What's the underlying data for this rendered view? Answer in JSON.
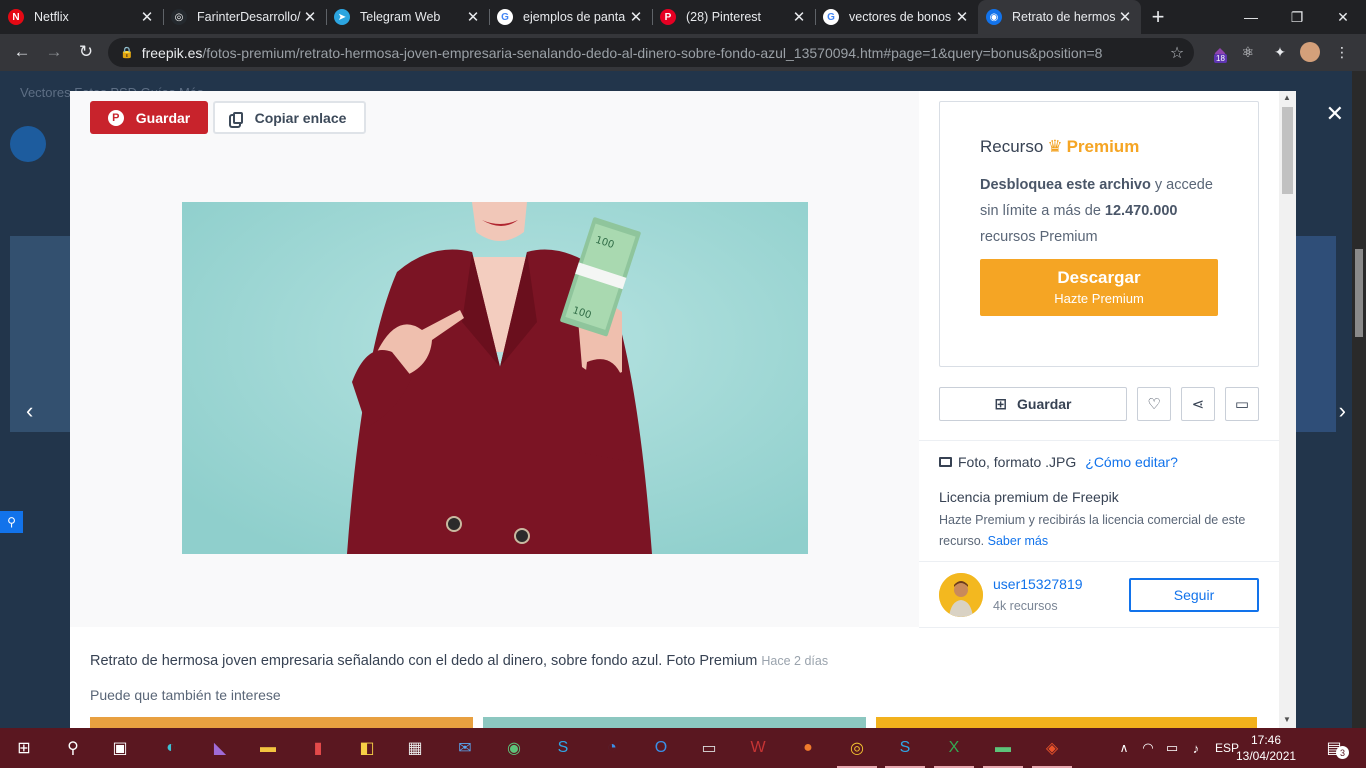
{
  "browser": {
    "tabs": [
      {
        "title": "Netflix",
        "favicon": "netflix-icon",
        "color": "#e50914",
        "glyph": "N",
        "active": false
      },
      {
        "title": "FarinterDesarrollo/",
        "favicon": "github-icon",
        "color": "#24292e",
        "glyph": "◎",
        "active": false
      },
      {
        "title": "Telegram Web",
        "favicon": "telegram-icon",
        "color": "#2ca5e0",
        "glyph": "➤",
        "active": false
      },
      {
        "title": "ejemplos de panta",
        "favicon": "google-icon",
        "color": "#ffffff",
        "glyph": "G",
        "active": false
      },
      {
        "title": "(28) Pinterest",
        "favicon": "pinterest-icon",
        "color": "#e60023",
        "glyph": "P",
        "active": false
      },
      {
        "title": "vectores de bonos",
        "favicon": "google-icon",
        "color": "#ffffff",
        "glyph": "G",
        "active": false
      },
      {
        "title": "Retrato de hermos",
        "favicon": "freepik-icon",
        "color": "#1273eb",
        "glyph": "◉",
        "active": true
      }
    ],
    "url_domain": "freepik.es",
    "url_path": "/fotos-premium/retrato-hermosa-joven-empresaria-senalando-dedo-al-dinero-sobre-fondo-azul_13570094.htm#page=1&query=bonus&position=8",
    "ext_badge": "18"
  },
  "backdrop": {
    "nav_text": "Vectores   Fotos   PSD   Guías   Más"
  },
  "modal": {
    "pin_save_label": "Guardar",
    "copy_link_label": "Copiar enlace",
    "premium": {
      "title_prefix": "Recurso",
      "title_premium": "Premium",
      "desc_bold1": "Desbloquea este archivo",
      "desc_text1": " y accede sin límite a más de ",
      "desc_bold2": "12.470.000",
      "desc_text2": " recursos Premium",
      "download_label": "Descargar",
      "download_sub": "Hazte Premium"
    },
    "save_label": "Guardar",
    "format_text": "Foto, formato .JPG",
    "howto_link": "¿Cómo editar?",
    "license_title": "Licencia premium de Freepik",
    "license_desc": "Hazte Premium y recibirás la licencia comercial de este recurso.",
    "license_link": "Saber más",
    "author_name": "user15327819",
    "author_count": "4k recursos",
    "follow_label": "Seguir",
    "description": "Retrato de hermosa joven empresaria señalando con el dedo al dinero, sobre fondo azul. Foto Premium",
    "description_ago": "Hace 2 días",
    "related_label": "Puede que también te interese"
  },
  "taskbar": {
    "language": "ESP",
    "time": "17:46",
    "date": "13/04/2021",
    "notifications": "3"
  }
}
